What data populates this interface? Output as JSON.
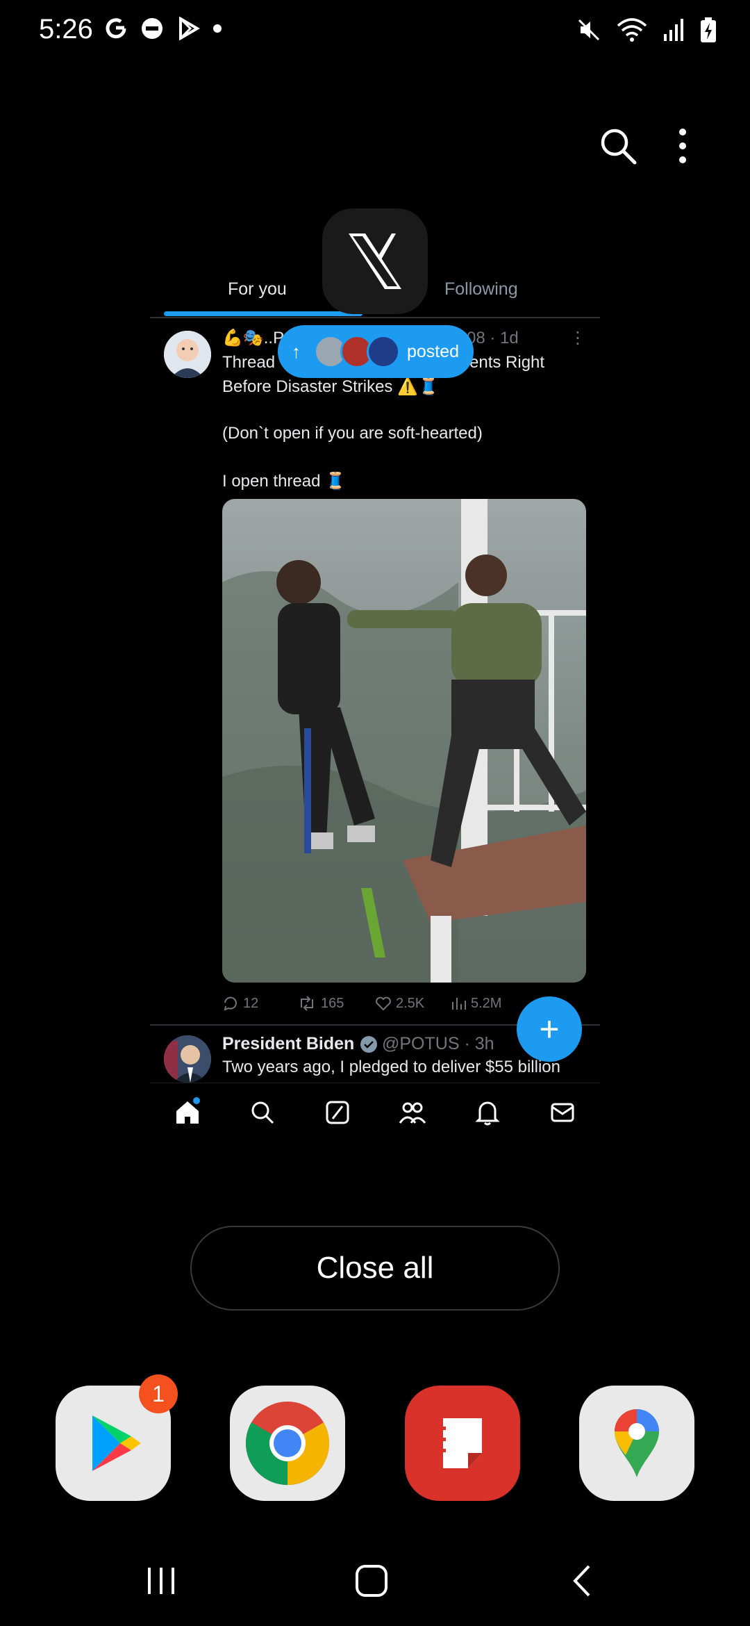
{
  "status_bar": {
    "time": "5:26",
    "left_icons": [
      "google-icon",
      "do-not-disturb-icon",
      "play-store-icon",
      "dot-icon"
    ],
    "right_icons": [
      "mute-icon",
      "wifi-icon",
      "signal-icon",
      "battery-charging-icon"
    ]
  },
  "recents_toolbar": {
    "icons": [
      "search-icon",
      "more-vert-icon"
    ]
  },
  "app_card": {
    "app_name": "X",
    "tabs": [
      {
        "label": "For you",
        "active": true
      },
      {
        "label": "Following",
        "active": false
      }
    ],
    "posted_pill": {
      "label": "posted"
    },
    "post1": {
      "name_fragment": "💪🎭..P",
      "meta": "08 · 1d",
      "line1_left": "Thread",
      "line1_right": "ents Right",
      "line2": "Before Disaster Strikes ⚠️🧵",
      "line3": "(Don`t open if you are soft-hearted)",
      "line4": "I open thread 🧵",
      "stats": {
        "replies": "12",
        "reposts": "165",
        "likes": "2.5K",
        "views": "5.2M"
      }
    },
    "post2": {
      "name": "President Biden",
      "handle_time": "@POTUS · 3h",
      "text": "Two years ago, I pledged to deliver $55 billion"
    },
    "bottom_nav": [
      "home-icon",
      "search-icon",
      "grok-icon",
      "communities-icon",
      "notifications-icon",
      "messages-icon"
    ]
  },
  "close_all_label": "Close all",
  "dock": {
    "apps": [
      {
        "name": "play-store",
        "badge": "1"
      },
      {
        "name": "chrome",
        "badge": ""
      },
      {
        "name": "samsung-notes",
        "badge": ""
      },
      {
        "name": "google-maps",
        "badge": ""
      }
    ]
  },
  "colors": {
    "accent": "#1d9bf0",
    "background": "#000000",
    "badge": "#f4511e"
  }
}
